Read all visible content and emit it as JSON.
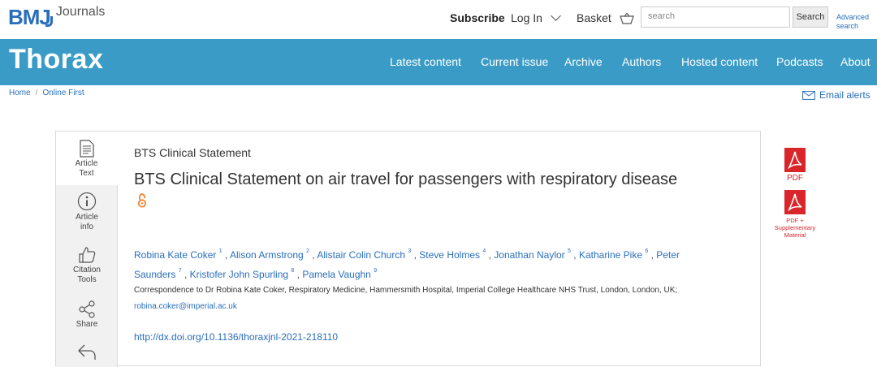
{
  "brand": {
    "logo": "BMJ",
    "journals_label": "Journals"
  },
  "top_links": {
    "subscribe": "Subscribe",
    "login": "Log In",
    "basket": "Basket"
  },
  "search": {
    "placeholder": "search",
    "button": "Search",
    "advanced": "Advanced search"
  },
  "journal": {
    "title": "Thorax"
  },
  "nav": [
    "Latest content",
    "Current issue",
    "Archive",
    "Authors",
    "Hosted content",
    "Podcasts",
    "About"
  ],
  "breadcrumb": {
    "home": "Home",
    "sep": "/",
    "current": "Online First"
  },
  "email_alerts": "Email alerts",
  "sidebar": [
    {
      "icon": "document-icon",
      "label": "Article Text"
    },
    {
      "icon": "info-icon",
      "label": "Article info"
    },
    {
      "icon": "thumbs-up-icon",
      "label": "Citation Tools"
    },
    {
      "icon": "share-icon",
      "label": "Share"
    },
    {
      "icon": "back-arrow-icon",
      "label": ""
    }
  ],
  "article": {
    "type": "BTS Clinical Statement",
    "title": "BTS Clinical Statement on air travel for passengers with respiratory disease",
    "authors": [
      {
        "name": "Robina Kate Coker",
        "sup": "1"
      },
      {
        "name": "Alison Armstrong",
        "sup": "2"
      },
      {
        "name": "Alistair Colin Church",
        "sup": "3"
      },
      {
        "name": "Steve Holmes",
        "sup": "4"
      },
      {
        "name": "Jonathan Naylor",
        "sup": "5"
      },
      {
        "name": "Katharine Pike",
        "sup": "6"
      },
      {
        "name": "Peter Saunders",
        "sup": "7"
      },
      {
        "name": "Kristofer John Spurling",
        "sup": "8"
      },
      {
        "name": "Pamela Vaughn",
        "sup": "9"
      }
    ],
    "correspondence": "Correspondence to Dr Robina Kate Coker, Respiratory Medicine, Hammersmith Hospital, Imperial College Healthcare NHS Trust, London, London, UK;",
    "correspondence_email": "robina.coker@imperial.ac.uk",
    "doi": "http://dx.doi.org/10.1136/thoraxjnl-2021-218110"
  },
  "downloads": {
    "pdf": "PDF",
    "pdf_supp": "PDF + Supplementary Material"
  },
  "colors": {
    "brand_blue": "#2a6ebb",
    "band": "#3a9cc6",
    "pdf_red": "#d9262b",
    "oa_orange": "#f0822e"
  }
}
